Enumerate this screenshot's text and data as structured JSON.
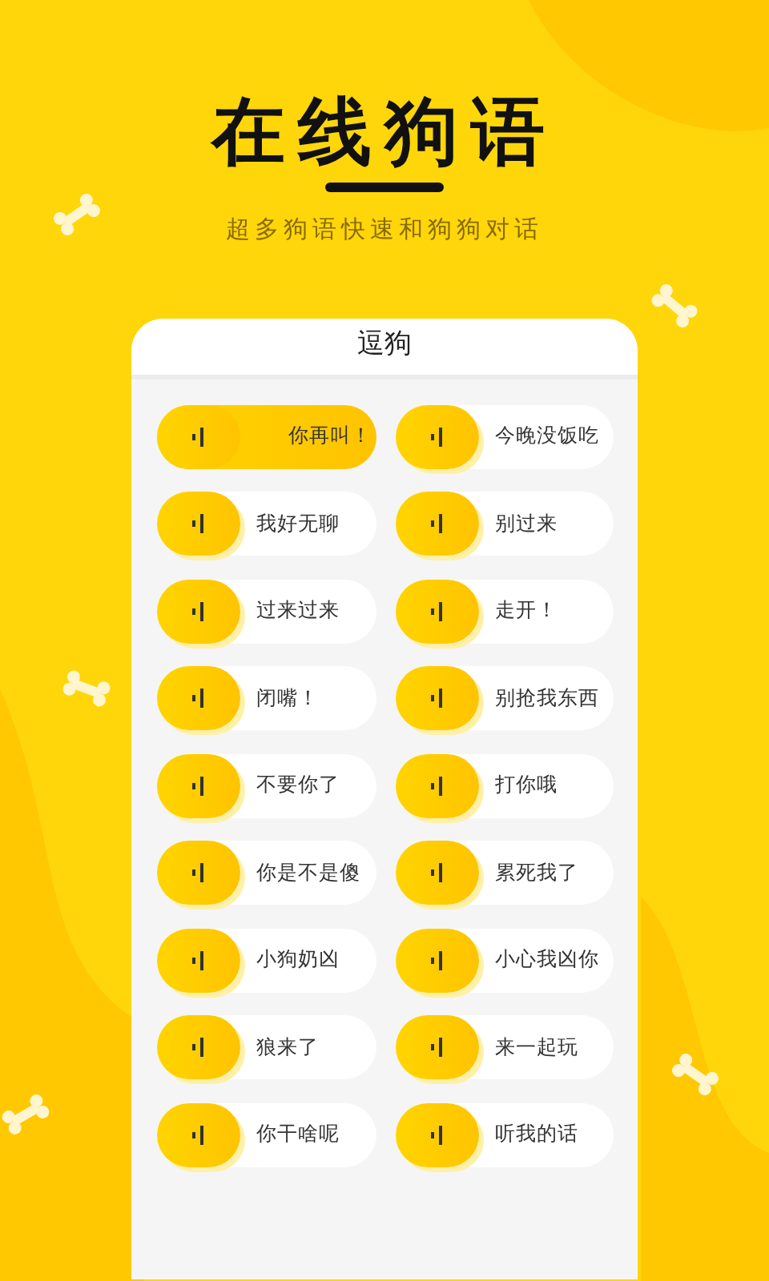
{
  "header": {
    "title": "在线狗语",
    "subtitle": "超多狗语快速和狗狗对话"
  },
  "screen": {
    "title": "逗狗",
    "phrases": [
      {
        "text": "你再叫！",
        "selected": true
      },
      {
        "text": "今晚没饭吃",
        "selected": false
      },
      {
        "text": "我好无聊",
        "selected": false
      },
      {
        "text": "别过来",
        "selected": false
      },
      {
        "text": "过来过来",
        "selected": false
      },
      {
        "text": "走开！",
        "selected": false
      },
      {
        "text": "闭嘴！",
        "selected": false
      },
      {
        "text": "别抢我东西",
        "selected": false
      },
      {
        "text": "不要你了",
        "selected": false
      },
      {
        "text": "打你哦",
        "selected": false
      },
      {
        "text": "你是不是傻",
        "selected": false
      },
      {
        "text": "累死我了",
        "selected": false
      },
      {
        "text": "小狗奶凶",
        "selected": false
      },
      {
        "text": "小心我凶你",
        "selected": false
      },
      {
        "text": "狼来了",
        "selected": false
      },
      {
        "text": "来一起玩",
        "selected": false
      },
      {
        "text": "你干啥呢",
        "selected": false
      },
      {
        "text": "听我的话",
        "selected": false
      }
    ]
  }
}
